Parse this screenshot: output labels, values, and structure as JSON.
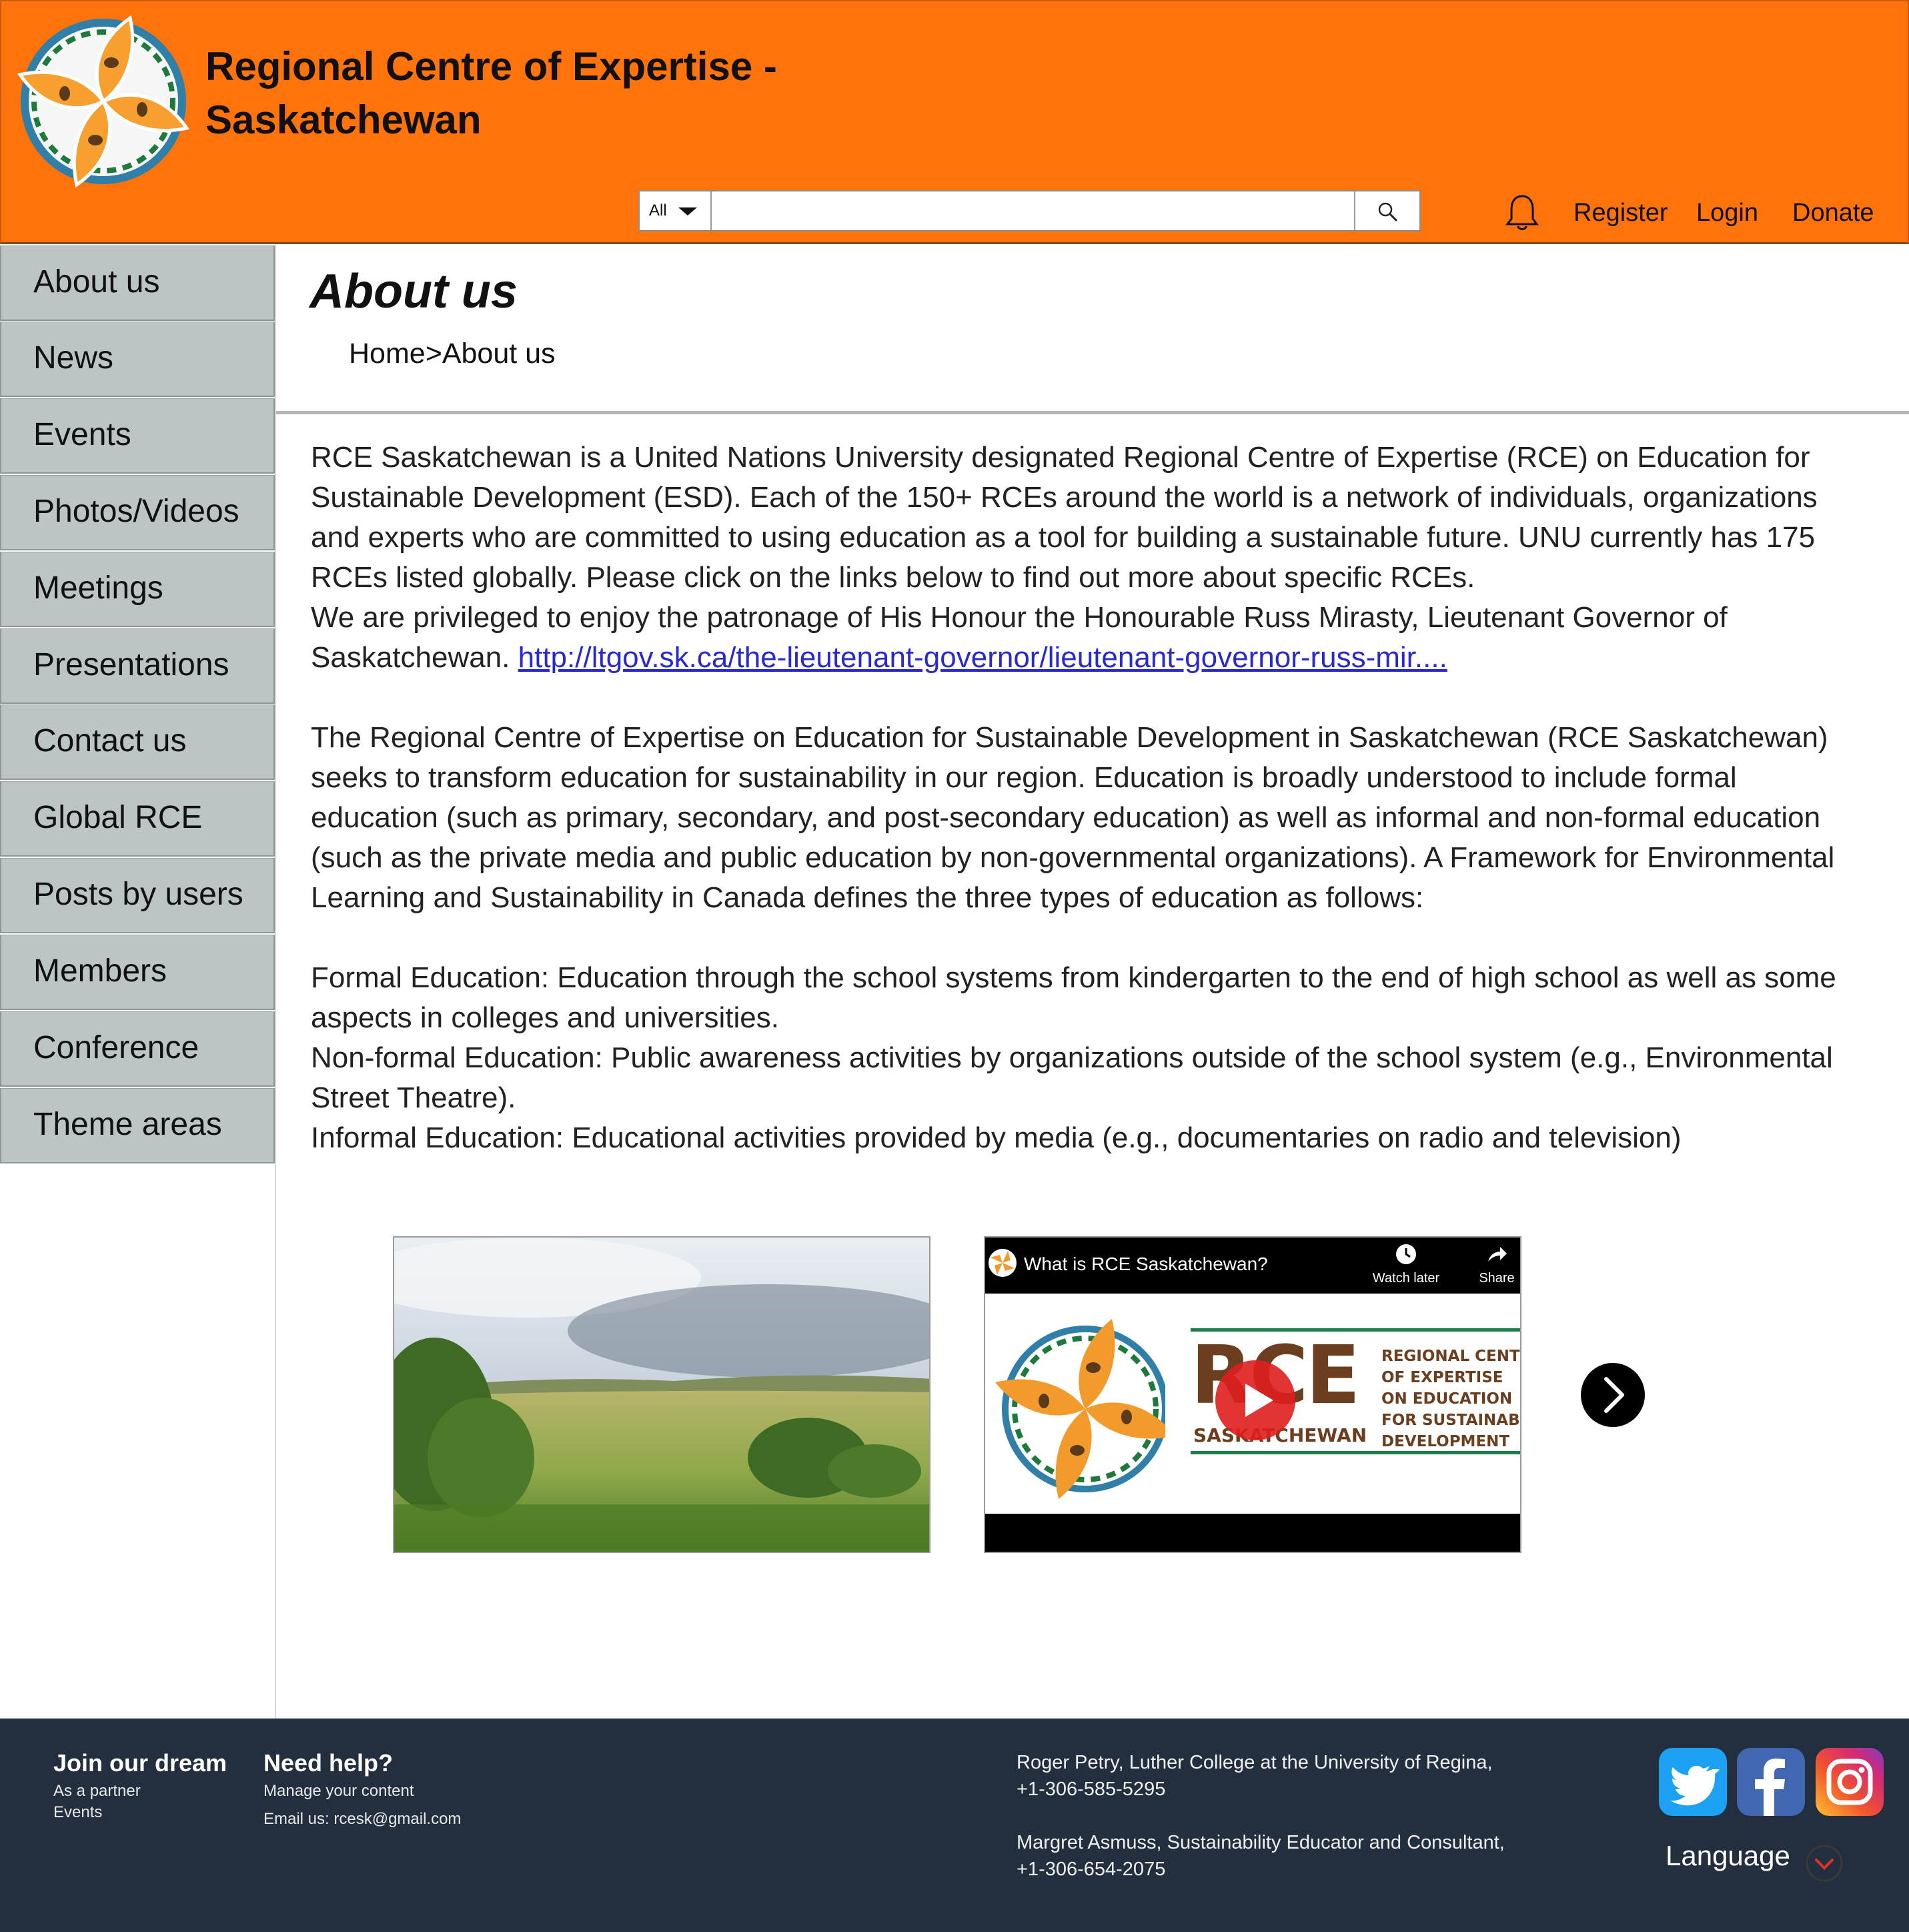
{
  "header": {
    "title_line1": "Regional Centre of Expertise -",
    "title_line2": "Saskatchewan",
    "search": {
      "scope": "All",
      "placeholder": ""
    },
    "links": {
      "register": "Register",
      "login": "Login",
      "donate": "Donate"
    },
    "brand_color": "#ff730d"
  },
  "sidebar": {
    "items": [
      {
        "label": "About us"
      },
      {
        "label": "News"
      },
      {
        "label": "Events"
      },
      {
        "label": "Photos/Videos"
      },
      {
        "label": "Meetings"
      },
      {
        "label": "Presentations"
      },
      {
        "label": "Contact us"
      },
      {
        "label": "Global RCE"
      },
      {
        "label": "Posts by users"
      },
      {
        "label": "Members"
      },
      {
        "label": "Conference"
      },
      {
        "label": "Theme areas"
      }
    ]
  },
  "main": {
    "title": "About us",
    "breadcrumb": {
      "home": "Home",
      "sep": ">",
      "current": "About us"
    },
    "intro": "RCE Saskatchewan is a United Nations University designated Regional Centre of Expertise (RCE) on Education for Sustainable Development (ESD). Each of the 150+ RCEs around the world is a network of individuals, organizations and experts who are committed to using education as a tool for building a sustainable future. UNU currently has 175 RCEs listed globally. Please click on the links below to find out more about specific RCEs.",
    "patronage": "We are privileged to enjoy the patronage of His Honour the Honourable Russ Mirasty, Lieutenant Governor of Saskatchewan. ",
    "patronage_link": "http://ltgov.sk.ca/the-lieutenant-governor/lieutenant-governor-russ-mir....",
    "paragraph2": "The Regional Centre of Expertise on Education for Sustainable Development in Saskatchewan (RCE Saskatchewan) seeks to transform education for sustainability in our region. Education is broadly understood to include formal education (such as primary, secondary, and post-secondary education) as well as informal and non-formal education (such as the private media and public education by non-governmental organizations). A Framework for Environmental Learning and Sustainability in Canada defines the three types of education as follows:",
    "formal": "Formal Education: Education through the school systems from kindergarten to the end of high school as well as some aspects in colleges and universities.",
    "nonformal": "Non-formal Education: Public awareness activities by organizations outside of the school system (e.g., Environmental Street Theatre).",
    "informal": "Informal Education: Educational activities provided by media (e.g., documentaries on radio and television)",
    "video": {
      "title": "What is RCE Saskatchewan?",
      "watch_later": "Watch later",
      "share": "Share",
      "logo_big": "RCE",
      "logo_sub": "SASKATCHEWAN",
      "logo_lines": [
        "REGIONAL CENTR",
        "OF EXPERTISE",
        "ON EDUCATION",
        "FOR SUSTAINABL",
        "DEVELOPMENT"
      ]
    }
  },
  "footer": {
    "join": {
      "heading": "Join our dream",
      "items": [
        "As a partner",
        "Events"
      ]
    },
    "help": {
      "heading": "Need help?",
      "items": [
        "Manage your content",
        "Email us: rcesk@gmail.com"
      ]
    },
    "contact1_line1": "Roger Petry, Luther College at the University of Regina,",
    "contact1_line2": "+1-306-585-5295",
    "contact2_line1": "Margret Asmuss, Sustainability Educator and Consultant,",
    "contact2_line2": "+1-306-654-2075",
    "language": "Language",
    "footer_color": "#232e3e"
  }
}
